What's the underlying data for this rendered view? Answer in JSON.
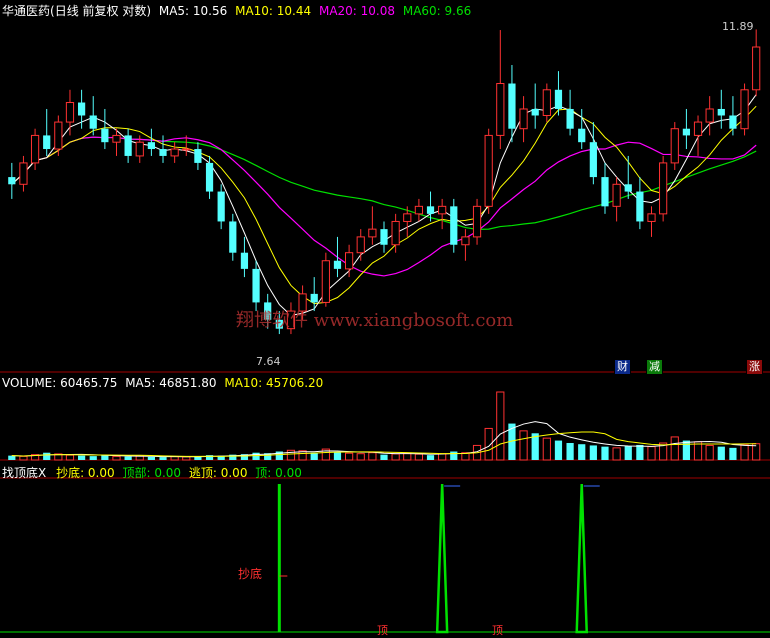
{
  "price_panel": {
    "stock_name": "华通医药",
    "mode": "(日线 前复权 对数)",
    "ma5": "MA5: 10.56",
    "ma10": "MA10: 10.44",
    "ma20": "MA20: 10.08",
    "ma60": "MA60: 9.66",
    "high_label": "11.89",
    "low_label": "7.64",
    "watermark": "翔博软件 www.xiangbosoft.com",
    "badges": {
      "cai": "财",
      "jian": "减",
      "zhang": "涨"
    },
    "colors": {
      "up": "#ff3232",
      "down": "#54ffff",
      "ma5": "#ffffff",
      "ma10": "#ffff00",
      "ma20": "#ff00ff",
      "ma60": "#00e000"
    }
  },
  "volume_panel": {
    "label": "VOLUME: 60465.75",
    "ma5": "MA5: 46851.80",
    "ma10": "MA10: 45706.20"
  },
  "indicator_panel": {
    "name": "找顶底X",
    "chaodi": "抄底: 0.00",
    "dingbu": "顶部: 0.00",
    "taoding": "逃顶: 0.00",
    "ding": "顶: 0.00",
    "annotation_chaodi": "抄底",
    "annotation_ding_1": "顶",
    "annotation_ding_2": "顶"
  },
  "chart_data": {
    "type": "candlestick",
    "price_range": [
      7.64,
      11.89
    ],
    "candles": [
      [
        9.6,
        9.8,
        9.3,
        9.5
      ],
      [
        9.5,
        9.9,
        9.4,
        9.8
      ],
      [
        9.8,
        10.3,
        9.7,
        10.2
      ],
      [
        10.2,
        10.6,
        9.9,
        10.0
      ],
      [
        10.0,
        10.5,
        9.9,
        10.4
      ],
      [
        10.4,
        10.9,
        10.2,
        10.7
      ],
      [
        10.7,
        10.9,
        10.3,
        10.5
      ],
      [
        10.5,
        10.8,
        10.2,
        10.3
      ],
      [
        10.3,
        10.6,
        10.0,
        10.1
      ],
      [
        10.1,
        10.3,
        9.9,
        10.2
      ],
      [
        10.2,
        10.3,
        9.8,
        9.9
      ],
      [
        9.9,
        10.2,
        9.8,
        10.1
      ],
      [
        10.1,
        10.3,
        9.9,
        10.0
      ],
      [
        10.0,
        10.2,
        9.8,
        9.9
      ],
      [
        9.9,
        10.1,
        9.8,
        10.0
      ],
      [
        10.0,
        10.2,
        9.9,
        10.0
      ],
      [
        10.0,
        10.1,
        9.7,
        9.8
      ],
      [
        9.8,
        9.9,
        9.3,
        9.4
      ],
      [
        9.4,
        9.5,
        8.9,
        9.0
      ],
      [
        9.0,
        9.1,
        8.5,
        8.6
      ],
      [
        8.6,
        8.8,
        8.3,
        8.4
      ],
      [
        8.4,
        8.5,
        7.9,
        8.0
      ],
      [
        8.0,
        8.1,
        7.7,
        7.8
      ],
      [
        7.8,
        7.9,
        7.64,
        7.7
      ],
      [
        7.7,
        8.0,
        7.64,
        7.9
      ],
      [
        7.9,
        8.2,
        7.8,
        8.1
      ],
      [
        8.1,
        8.3,
        7.9,
        8.0
      ],
      [
        8.0,
        8.6,
        7.95,
        8.5
      ],
      [
        8.5,
        8.8,
        8.3,
        8.4
      ],
      [
        8.4,
        8.7,
        8.3,
        8.6
      ],
      [
        8.6,
        8.9,
        8.5,
        8.8
      ],
      [
        8.8,
        9.2,
        8.7,
        8.9
      ],
      [
        8.9,
        9.0,
        8.6,
        8.7
      ],
      [
        8.7,
        9.1,
        8.6,
        9.0
      ],
      [
        9.0,
        9.2,
        8.8,
        9.1
      ],
      [
        9.1,
        9.3,
        9.0,
        9.2
      ],
      [
        9.2,
        9.4,
        9.0,
        9.1
      ],
      [
        9.1,
        9.3,
        8.9,
        9.2
      ],
      [
        9.2,
        9.3,
        8.6,
        8.7
      ],
      [
        8.7,
        8.9,
        8.5,
        8.8
      ],
      [
        8.8,
        9.3,
        8.7,
        9.2
      ],
      [
        9.2,
        10.3,
        9.1,
        10.2
      ],
      [
        10.2,
        11.89,
        10.0,
        11.0
      ],
      [
        11.0,
        11.3,
        10.1,
        10.3
      ],
      [
        10.3,
        10.8,
        10.1,
        10.6
      ],
      [
        10.6,
        11.0,
        10.3,
        10.5
      ],
      [
        10.5,
        11.0,
        10.4,
        10.9
      ],
      [
        10.9,
        11.2,
        10.5,
        10.6
      ],
      [
        10.6,
        10.9,
        10.2,
        10.3
      ],
      [
        10.3,
        10.6,
        10.0,
        10.1
      ],
      [
        10.1,
        10.4,
        9.5,
        9.6
      ],
      [
        9.6,
        9.8,
        9.1,
        9.2
      ],
      [
        9.2,
        9.6,
        9.0,
        9.5
      ],
      [
        9.5,
        9.9,
        9.3,
        9.4
      ],
      [
        9.4,
        9.6,
        8.9,
        9.0
      ],
      [
        9.0,
        9.2,
        8.8,
        9.1
      ],
      [
        9.1,
        9.9,
        9.0,
        9.8
      ],
      [
        9.8,
        10.4,
        9.7,
        10.3
      ],
      [
        10.3,
        10.6,
        10.0,
        10.2
      ],
      [
        10.2,
        10.5,
        9.9,
        10.4
      ],
      [
        10.4,
        10.8,
        10.2,
        10.6
      ],
      [
        10.6,
        10.9,
        10.3,
        10.5
      ],
      [
        10.5,
        10.8,
        10.2,
        10.3
      ],
      [
        10.3,
        11.0,
        10.2,
        10.9
      ],
      [
        10.9,
        11.9,
        10.8,
        11.6
      ]
    ],
    "volume": [
      18,
      15,
      22,
      30,
      25,
      20,
      18,
      16,
      20,
      15,
      14,
      16,
      13,
      12,
      14,
      13,
      15,
      20,
      18,
      22,
      24,
      30,
      28,
      35,
      40,
      38,
      30,
      45,
      32,
      28,
      26,
      30,
      22,
      25,
      28,
      24,
      20,
      26,
      35,
      30,
      60,
      130,
      280,
      150,
      120,
      110,
      90,
      80,
      70,
      65,
      60,
      55,
      50,
      58,
      62,
      55,
      70,
      95,
      80,
      75,
      60,
      55,
      50,
      62,
      67
    ],
    "indicator_spikes": {
      "chaodi_index": 23,
      "ding_indices": [
        37,
        49
      ]
    }
  }
}
